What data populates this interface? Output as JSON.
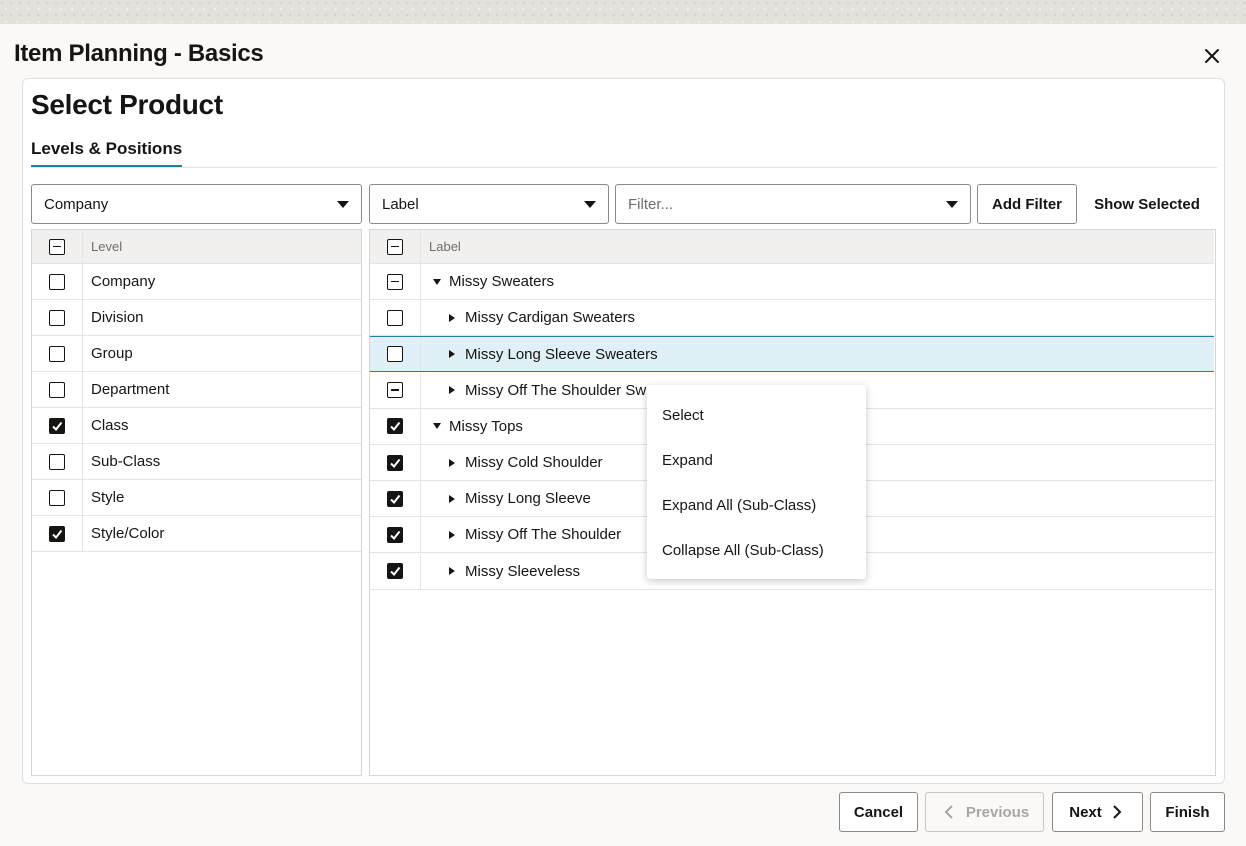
{
  "dialog": {
    "title": "Item Planning - Basics",
    "close_icon": "close-icon"
  },
  "section": {
    "title": "Select Product",
    "tab_label": "Levels & Positions"
  },
  "filters": {
    "hierarchy_value": "Company",
    "attribute_value": "Label",
    "filter_placeholder": "Filter...",
    "add_filter_label": "Add Filter",
    "show_selected_label": "Show Selected"
  },
  "levels_panel": {
    "header": "Level",
    "header_state": "partial",
    "items": [
      {
        "label": "Company",
        "state": "unchecked"
      },
      {
        "label": "Division",
        "state": "unchecked"
      },
      {
        "label": "Group",
        "state": "unchecked"
      },
      {
        "label": "Department",
        "state": "unchecked"
      },
      {
        "label": "Class",
        "state": "checked"
      },
      {
        "label": "Sub-Class",
        "state": "unchecked"
      },
      {
        "label": "Style",
        "state": "unchecked"
      },
      {
        "label": "Style/Color",
        "state": "checked"
      }
    ]
  },
  "positions_panel": {
    "header": "Label",
    "header_state": "partial",
    "rows": [
      {
        "label": "Missy Sweaters",
        "state": "partial",
        "depth": 0,
        "expanded": true
      },
      {
        "label": "Missy Cardigan Sweaters",
        "state": "unchecked",
        "depth": 1,
        "expanded": false
      },
      {
        "label": "Missy Long Sleeve Sweaters",
        "state": "unchecked",
        "depth": 1,
        "expanded": false,
        "selected": true
      },
      {
        "label": "Missy Off The Shoulder Sw",
        "state": "partial",
        "depth": 1,
        "expanded": false
      },
      {
        "label": "Missy Tops",
        "state": "checked",
        "depth": 0,
        "expanded": true
      },
      {
        "label": "Missy Cold Shoulder",
        "state": "checked",
        "depth": 1,
        "expanded": false
      },
      {
        "label": "Missy Long Sleeve",
        "state": "checked",
        "depth": 1,
        "expanded": false
      },
      {
        "label": "Missy Off The Shoulder",
        "state": "checked",
        "depth": 1,
        "expanded": false
      },
      {
        "label": "Missy Sleeveless",
        "state": "checked",
        "depth": 1,
        "expanded": false
      }
    ]
  },
  "context_menu": {
    "items": [
      "Select",
      "Expand",
      "Expand All (Sub-Class)",
      "Collapse All (Sub-Class)"
    ]
  },
  "footer": {
    "cancel_label": "Cancel",
    "previous_label": "Previous",
    "next_label": "Next",
    "finish_label": "Finish"
  },
  "colors": {
    "accent": "#227e9e",
    "selected_row": "#e0f0f7",
    "text": "#161513"
  }
}
